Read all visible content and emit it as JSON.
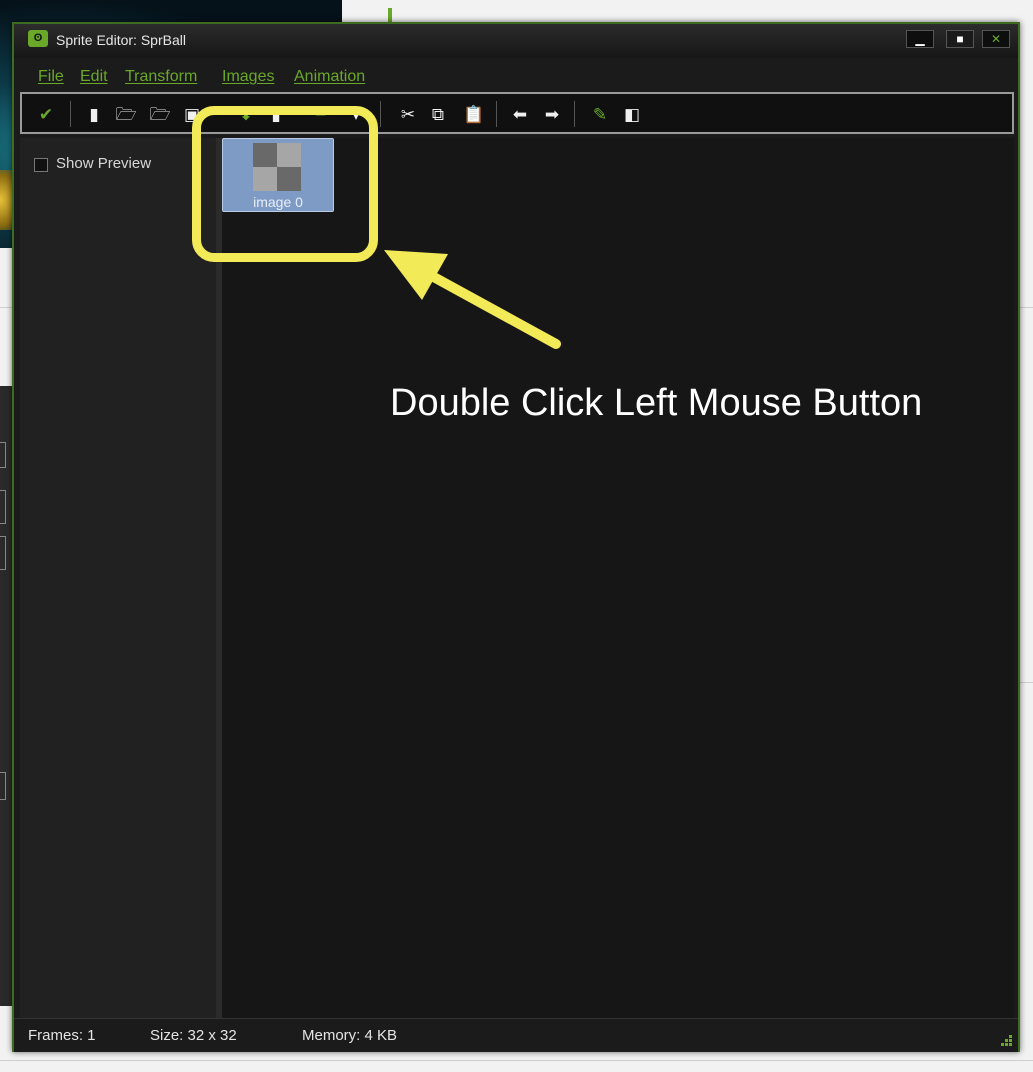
{
  "window": {
    "title": "Sprite Editor: SprBall",
    "app_icon": "gamemaker-logo-icon",
    "controls": [
      "minimize",
      "maximize",
      "close"
    ]
  },
  "menu": {
    "items": [
      {
        "label": "File"
      },
      {
        "label": "Edit"
      },
      {
        "label": "Transform"
      },
      {
        "label": "Images"
      },
      {
        "label": "Animation"
      }
    ]
  },
  "toolbar": {
    "icons": [
      "confirm-check-icon",
      "new-sprite-icon",
      "open-icon",
      "add-from-file-icon",
      "save-icon",
      "import-icon",
      "export-icon",
      "add-image-icon",
      "insert-image-icon",
      "cut-icon",
      "copy-icon",
      "paste-icon",
      "move-left-icon",
      "move-right-icon",
      "edit-image-icon",
      "merge-icon"
    ]
  },
  "sidebar": {
    "show_preview_label": "Show Preview",
    "show_preview_checked": false
  },
  "frames": [
    {
      "label": "image 0",
      "selected": true
    }
  ],
  "status": {
    "frames": "Frames: 1",
    "size": "Size: 32 x 32",
    "memory": "Memory: 4 KB"
  },
  "annotation": {
    "text": "Double Click Left Mouse Button",
    "color": "#f3ea58"
  },
  "colors": {
    "accent": "#6aa829",
    "window_bg": "#1b1b1b",
    "selection": "#7d9bc4"
  }
}
